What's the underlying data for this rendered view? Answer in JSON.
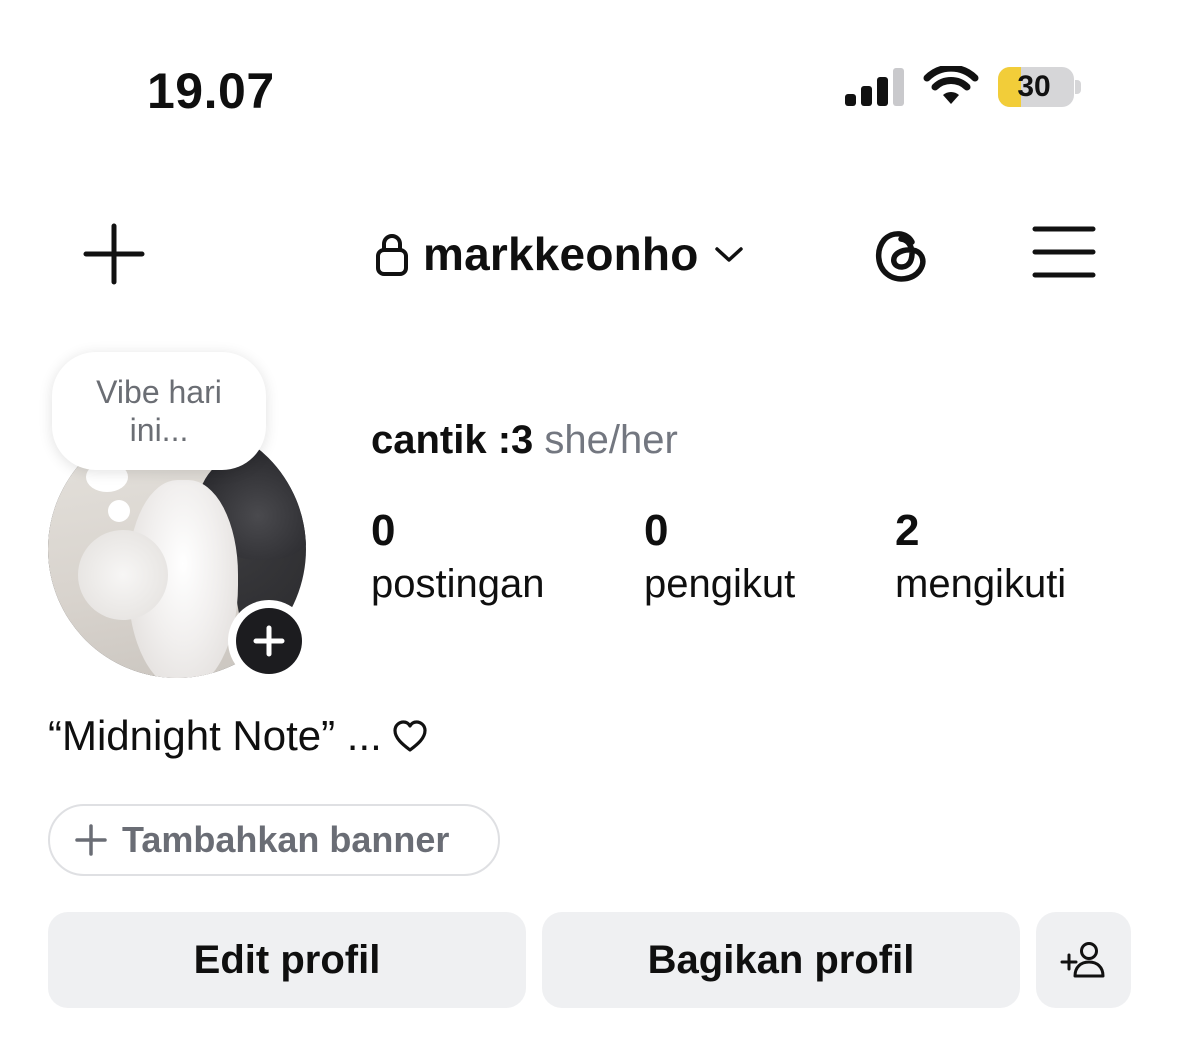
{
  "status_bar": {
    "time": "19.07",
    "battery_percent": "30",
    "battery_level": 0.3,
    "battery_color": "#f2cd39",
    "icons": [
      "cellular-signal-icon",
      "wifi-icon",
      "battery-icon"
    ]
  },
  "header": {
    "username": "markkeonho",
    "icons": [
      "plus-icon",
      "lock-icon",
      "chevron-down-icon",
      "threads-icon",
      "hamburger-menu-icon"
    ]
  },
  "note": {
    "placeholder": "Vibe hari ini..."
  },
  "profile": {
    "name": "cantik :3",
    "pronouns": "she/her",
    "stats": [
      {
        "count": "0",
        "label": "postingan"
      },
      {
        "count": "0",
        "label": "pengikut"
      },
      {
        "count": "2",
        "label": "mengikuti"
      }
    ],
    "bio": "“Midnight Note” ...",
    "bio_icon": "heart-outline-icon"
  },
  "actions": {
    "add_banner": "Tambahkan banner",
    "edit_profile": "Edit profil",
    "share_profile": "Bagikan profil",
    "discover_icon": "add-person-icon"
  }
}
